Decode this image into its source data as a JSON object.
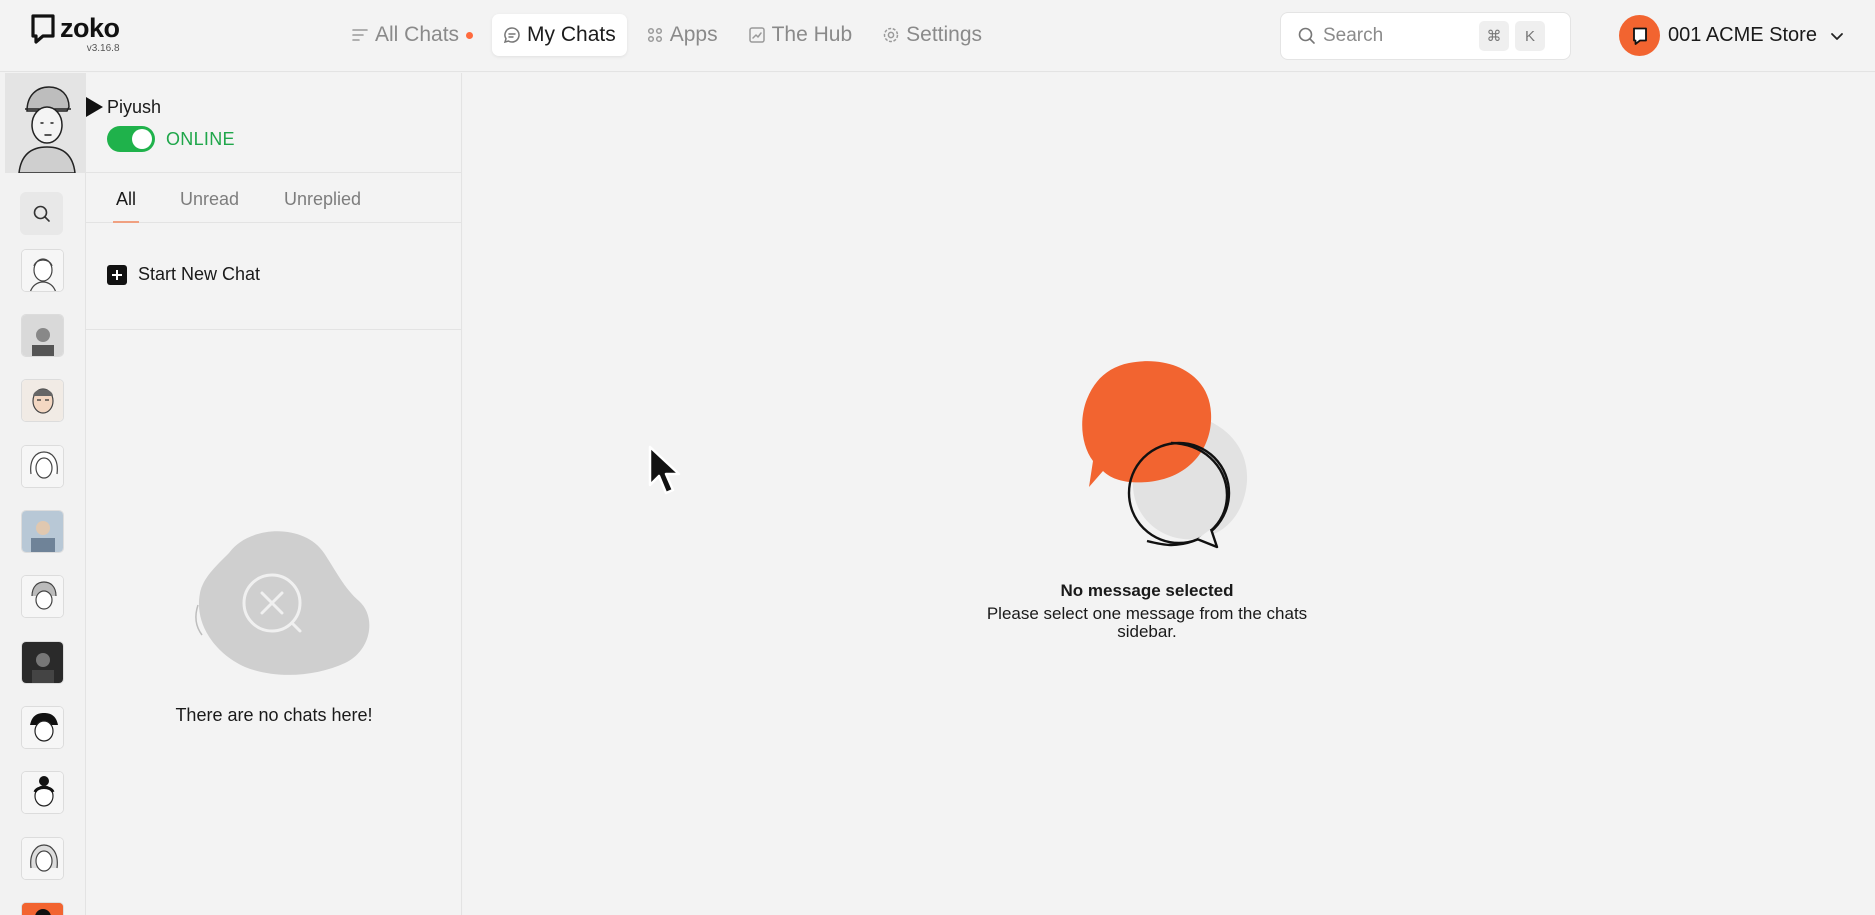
{
  "app": {
    "name": "zoko",
    "version": "v3.16.8"
  },
  "nav": {
    "items": [
      {
        "label": "All Chats",
        "icon": "filter-lines-icon",
        "unread_dot": true
      },
      {
        "label": "My Chats",
        "icon": "chat-bubble-icon",
        "active": true
      },
      {
        "label": "Apps",
        "icon": "apps-grid-icon"
      },
      {
        "label": "The Hub",
        "icon": "chart-icon"
      },
      {
        "label": "Settings",
        "icon": "gear-icon"
      }
    ]
  },
  "search": {
    "placeholder": "Search",
    "shortcut_keys": [
      "⌘",
      "K"
    ]
  },
  "store": {
    "name": "001 ACME Store"
  },
  "profile": {
    "name": "Piyush",
    "status": "ONLINE",
    "online": true
  },
  "tabs": [
    {
      "label": "All",
      "active": true
    },
    {
      "label": "Unread"
    },
    {
      "label": "Unreplied"
    }
  ],
  "sidebar": {
    "new_chat_label": "Start New Chat",
    "empty_text": "There are no chats here!"
  },
  "main": {
    "empty_title": "No message selected",
    "empty_subtitle": "Please select one message from the chats sidebar."
  },
  "colors": {
    "accent": "#f26430",
    "online": "#1fb24b",
    "background": "#f2f2f2"
  }
}
